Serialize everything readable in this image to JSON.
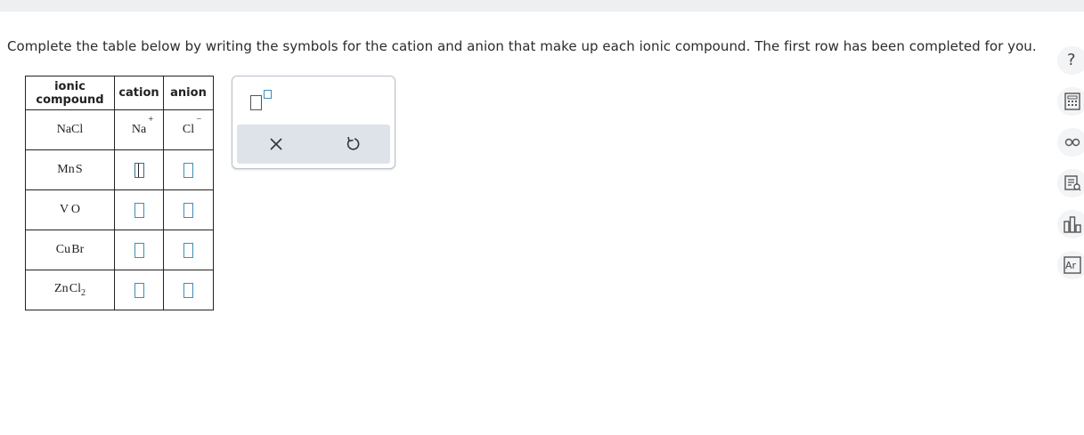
{
  "instruction": "Complete the table below by writing the symbols for the cation and anion that make up each ionic compound. The first row has been completed for you.",
  "table": {
    "headers": {
      "compound_line1": "ionic",
      "compound_line2": "compound",
      "cation": "cation",
      "anion": "anion"
    },
    "rows": [
      {
        "compound": "NaCl",
        "compound_a": "Na",
        "compound_b": "Cl",
        "cation_symbol": "Na",
        "cation_charge": "+",
        "anion_symbol": "Cl",
        "anion_charge": "−"
      },
      {
        "compound_a": "Mn",
        "compound_b": "S"
      },
      {
        "compound_a": "V",
        "compound_b": "O"
      },
      {
        "compound_a": "Cu",
        "compound_b": "Br"
      },
      {
        "compound_a": "Zn",
        "compound_b": "Cl",
        "compound_b_sub": "2"
      }
    ]
  },
  "palette": {
    "tools": [
      "superscript-tool",
      "clear",
      "undo"
    ]
  },
  "rail_icons": [
    "help-icon",
    "calculator-icon",
    "glasses-icon",
    "reference-icon",
    "chart-icon",
    "periodic-table-icon"
  ],
  "periodic_label": "Ar",
  "help_label": "?"
}
